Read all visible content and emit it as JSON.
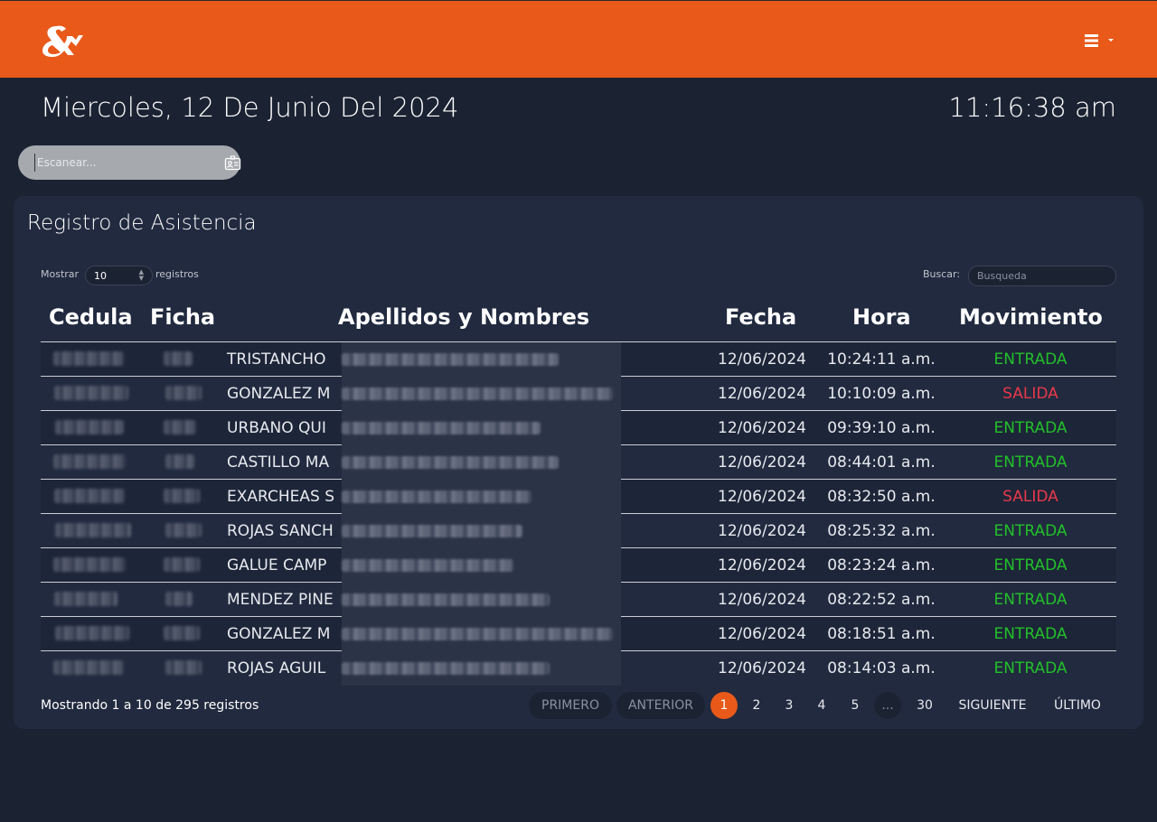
{
  "header": {
    "logo_text": "&",
    "menu_icon": "hamburger-icon",
    "brand_color": "#e8591a"
  },
  "datetime": {
    "date": "Miercoles, 12 De Junio Del 2024",
    "time": "11:16:38 am"
  },
  "scan": {
    "placeholder": "Escanear...",
    "icon": "id-card-icon"
  },
  "card": {
    "title": "Registro de Asistencia",
    "show_label": "Mostrar",
    "show_value": "10",
    "show_suffix": "registros",
    "search_label": "Buscar:",
    "search_placeholder": "Busqueda"
  },
  "table": {
    "columns": [
      "Cedula",
      "Ficha",
      "Apellidos y Nombres",
      "Fecha",
      "Hora",
      "Movimiento"
    ],
    "rows": [
      {
        "nombre": "TRISTANCHO",
        "fecha": "12/06/2024",
        "hora": "10:24:11 a.m.",
        "movimiento": "ENTRADA"
      },
      {
        "nombre": "GONZALEZ M",
        "fecha": "12/06/2024",
        "hora": "10:10:09 a.m.",
        "movimiento": "SALIDA"
      },
      {
        "nombre": "URBANO QUI",
        "fecha": "12/06/2024",
        "hora": "09:39:10 a.m.",
        "movimiento": "ENTRADA"
      },
      {
        "nombre": "CASTILLO MA",
        "fecha": "12/06/2024",
        "hora": "08:44:01 a.m.",
        "movimiento": "ENTRADA"
      },
      {
        "nombre": "EXARCHEAS S",
        "fecha": "12/06/2024",
        "hora": "08:32:50 a.m.",
        "movimiento": "SALIDA"
      },
      {
        "nombre": "ROJAS SANCH",
        "fecha": "12/06/2024",
        "hora": "08:25:32 a.m.",
        "movimiento": "ENTRADA"
      },
      {
        "nombre": "GALUE CAMP",
        "fecha": "12/06/2024",
        "hora": "08:23:24 a.m.",
        "movimiento": "ENTRADA"
      },
      {
        "nombre": "MENDEZ PINE",
        "fecha": "12/06/2024",
        "hora": "08:22:52 a.m.",
        "movimiento": "ENTRADA"
      },
      {
        "nombre": "GONZALEZ M",
        "fecha": "12/06/2024",
        "hora": "08:18:51 a.m.",
        "movimiento": "ENTRADA"
      },
      {
        "nombre": "ROJAS AGUIL",
        "fecha": "12/06/2024",
        "hora": "08:14:03 a.m.",
        "movimiento": "ENTRADA"
      }
    ]
  },
  "footer": {
    "info": "Mostrando 1 a 10 de 295 registros",
    "pager": {
      "first": "PRIMERO",
      "prev": "ANTERIOR",
      "pages": [
        "1",
        "2",
        "3",
        "4",
        "5"
      ],
      "ellipsis": "...",
      "last_page": "30",
      "next": "SIGUIENTE",
      "last": "ÚLTIMO",
      "current": "1"
    }
  },
  "colors": {
    "entrada": "#22c02a",
    "salida": "#e8394a",
    "background": "#1b2333",
    "card": "#212a3f"
  }
}
